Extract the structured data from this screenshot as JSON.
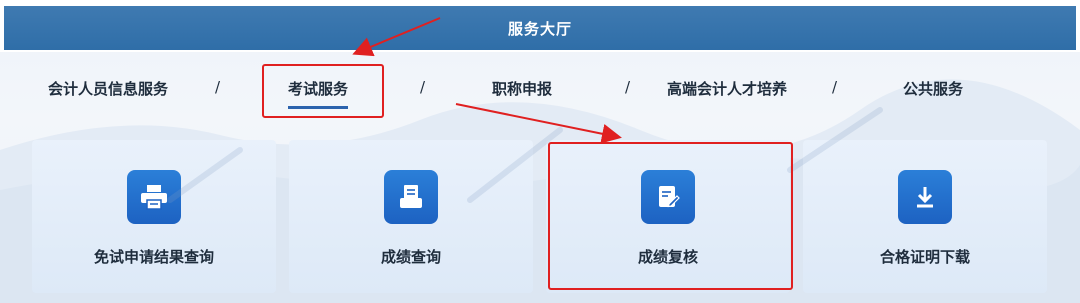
{
  "header": {
    "title": "服务大厅"
  },
  "tabs": [
    {
      "label": "会计人员信息服务",
      "active": false
    },
    {
      "label": "考试服务",
      "active": true
    },
    {
      "label": "职称申报",
      "active": false
    },
    {
      "label": "高端会计人才培养",
      "active": false
    },
    {
      "label": "公共服务",
      "active": false
    }
  ],
  "separator": "/",
  "cards": [
    {
      "label": "免试申请结果查询",
      "icon": "printer-icon"
    },
    {
      "label": "成绩查询",
      "icon": "score-printer-icon"
    },
    {
      "label": "成绩复核",
      "icon": "edit-document-icon"
    },
    {
      "label": "合格证明下载",
      "icon": "download-icon"
    }
  ],
  "colors": {
    "header_bar": "#2f6ea8",
    "icon_tile": "#1d62c2",
    "highlight": "#e02020"
  }
}
